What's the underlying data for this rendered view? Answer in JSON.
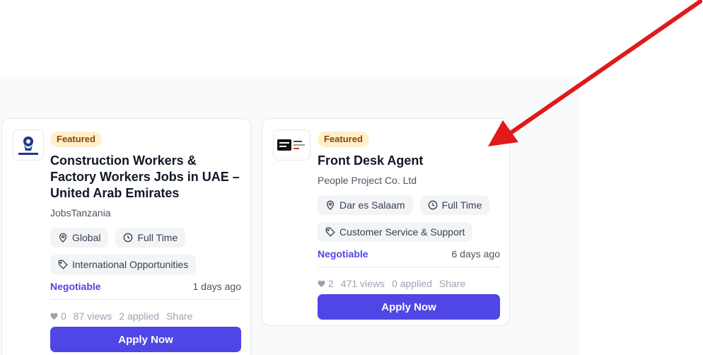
{
  "jobs": [
    {
      "badge": "Featured",
      "title": "Construction Workers & Factory Workers Jobs in UAE – United Arab Emirates",
      "company": "JobsTanzania",
      "logo_text": "JobsTanzania",
      "tags": [
        {
          "icon": "location-pin-icon",
          "label": "Global"
        },
        {
          "icon": "clock-icon",
          "label": "Full Time"
        },
        {
          "icon": "tag-icon",
          "label": "International Opportunities"
        }
      ],
      "salary": "Negotiable",
      "posted": "1 days ago",
      "likes": "0",
      "views": "87 views",
      "applied": "2 applied",
      "share": "Share",
      "apply": "Apply Now"
    },
    {
      "badge": "Featured",
      "title": "Front Desk Agent",
      "company": "People Project Co. Ltd",
      "logo_text": "People Project",
      "tags": [
        {
          "icon": "location-pin-icon",
          "label": "Dar es Salaam"
        },
        {
          "icon": "clock-icon",
          "label": "Full Time"
        },
        {
          "icon": "tag-icon",
          "label": "Customer Service & Support"
        }
      ],
      "salary": "Negotiable",
      "posted": "6 days ago",
      "likes": "2",
      "views": "471 views",
      "applied": "0 applied",
      "share": "Share",
      "apply": "Apply Now"
    }
  ],
  "colors": {
    "accent": "#4f46e5",
    "badge_bg": "#fdf0c8",
    "badge_text": "#92400e",
    "annotation_arrow": "#e0191b"
  }
}
